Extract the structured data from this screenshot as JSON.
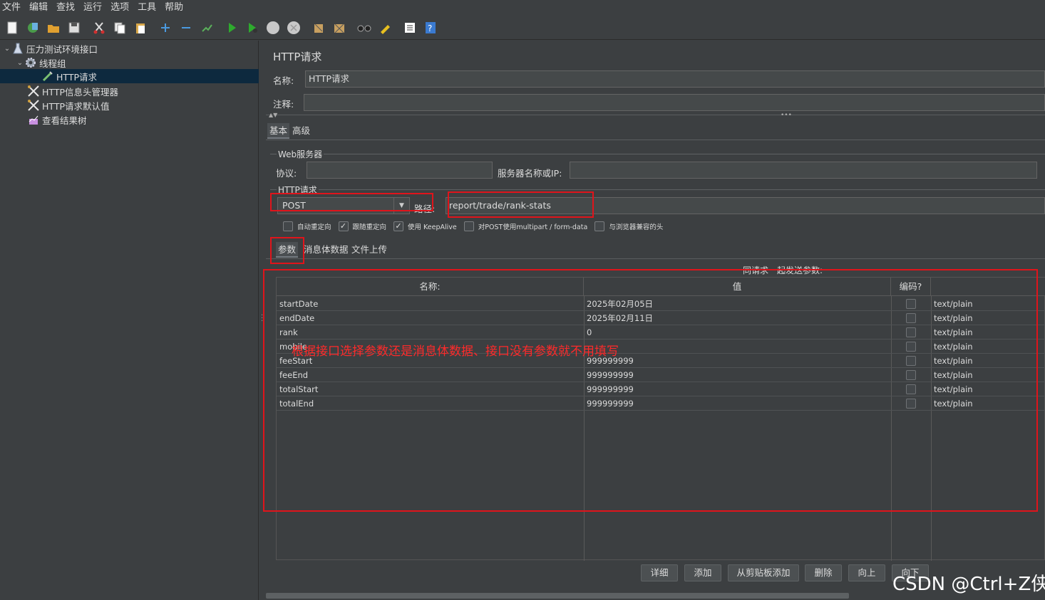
{
  "menu": [
    "文件",
    "编辑",
    "查找",
    "运行",
    "选项",
    "工具",
    "帮助"
  ],
  "toolbar": {
    "icons": [
      "new-icon",
      "templates-icon",
      "open-icon",
      "save-icon",
      "cut-icon",
      "copy-icon",
      "paste-icon",
      "expand-icon",
      "collapse-icon",
      "toggle-icon",
      "start-icon",
      "start-no-pause-icon",
      "stop-icon",
      "shutdown-icon",
      "clear-icon",
      "clear-all-icon",
      "search-icon",
      "reset-search-icon",
      "function-helper-icon",
      "help-icon"
    ]
  },
  "tree": {
    "root": "压力测试环境接口",
    "thread_group": "线程组",
    "http_request": "HTTP请求",
    "header_manager": "HTTP信息头管理器",
    "request_defaults": "HTTP请求默认值",
    "result_tree": "查看结果树"
  },
  "panel": {
    "title": "HTTP请求",
    "name_label": "名称:",
    "name_value": "HTTP请求",
    "comment_label": "注释:",
    "comment_value": "",
    "tabs": [
      "基本",
      "高级"
    ],
    "web_server_group": "Web服务器",
    "protocol_label": "协议:",
    "protocol_value": "",
    "server_label": "服务器名称或IP:",
    "server_value": "",
    "http_group": "HTTP请求",
    "method": "POST",
    "path_label": "路径:",
    "path_value": "report/trade/rank-stats",
    "options": [
      {
        "label": "自动重定向",
        "checked": false
      },
      {
        "label": "跟随重定向",
        "checked": true
      },
      {
        "label": "使用 KeepAlive",
        "checked": true
      },
      {
        "label": "对POST使用multipart / form-data",
        "checked": false
      },
      {
        "label": "与浏览器兼容的头",
        "checked": false
      }
    ],
    "sub_tabs": [
      "参数",
      "消息体数据",
      "文件上传"
    ],
    "params_hint": "同请求一起发送参数:",
    "columns": [
      "名称:",
      "值",
      "编码?",
      ""
    ],
    "params": [
      {
        "name": "startDate",
        "value": "2025年02月05日",
        "type": "text/plain"
      },
      {
        "name": "endDate",
        "value": "2025年02月11日",
        "type": "text/plain"
      },
      {
        "name": "rank",
        "value": "0",
        "type": "text/plain"
      },
      {
        "name": "mobile",
        "value": "",
        "type": "text/plain"
      },
      {
        "name": "feeStart",
        "value": "999999999",
        "type": "text/plain"
      },
      {
        "name": "feeEnd",
        "value": "999999999",
        "type": "text/plain"
      },
      {
        "name": "totalStart",
        "value": "999999999",
        "type": "text/plain"
      },
      {
        "name": "totalEnd",
        "value": "999999999",
        "type": "text/plain"
      }
    ],
    "annotation": "根据接口选择参数还是消息体数据、接口没有参数就不用填写",
    "buttons": [
      "详细",
      "添加",
      "从剪贴板添加",
      "删除",
      "向上",
      "向下"
    ]
  },
  "watermark": "CSDN @Ctrl+Z侠",
  "colors": {
    "background": "#3c3f41",
    "selected": "#0d293e",
    "annotation_red": "#e0141b"
  }
}
